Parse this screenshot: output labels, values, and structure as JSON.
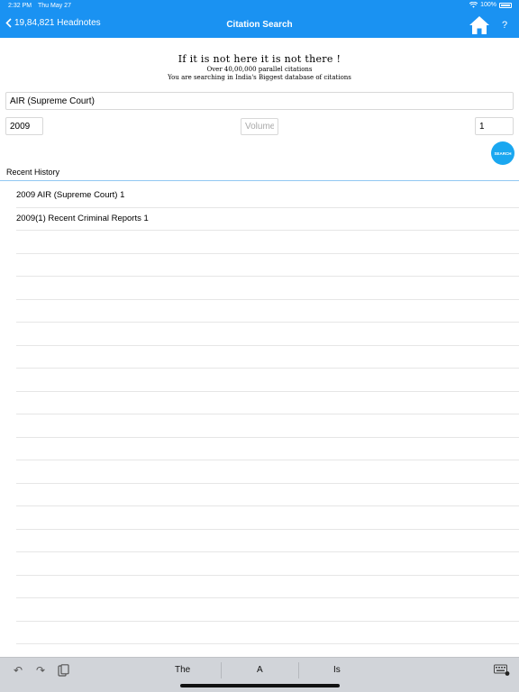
{
  "status_bar": {
    "time": "2:32 PM",
    "date": "Thu May 27",
    "battery": "100%"
  },
  "nav": {
    "back_label": "19,84,821 Headnotes",
    "title": "Citation Search",
    "help": "?"
  },
  "tagline": {
    "line1": "If it is not here it is not there !",
    "line2": "Over 40,00,000 parallel citations",
    "line3": "You are searching in India's Biggest database of citations"
  },
  "form": {
    "court_value": "AIR (Supreme Court)",
    "year_value": "2009",
    "volume_placeholder": "Volume",
    "page_value": "1",
    "search_label": "SEARCH"
  },
  "recent": {
    "label": "Recent History",
    "items": [
      "2009 AIR (Supreme Court) 1",
      "2009(1) Recent Criminal Reports 1"
    ]
  },
  "keyboard": {
    "suggestions": [
      "The",
      "A",
      "Is"
    ]
  }
}
